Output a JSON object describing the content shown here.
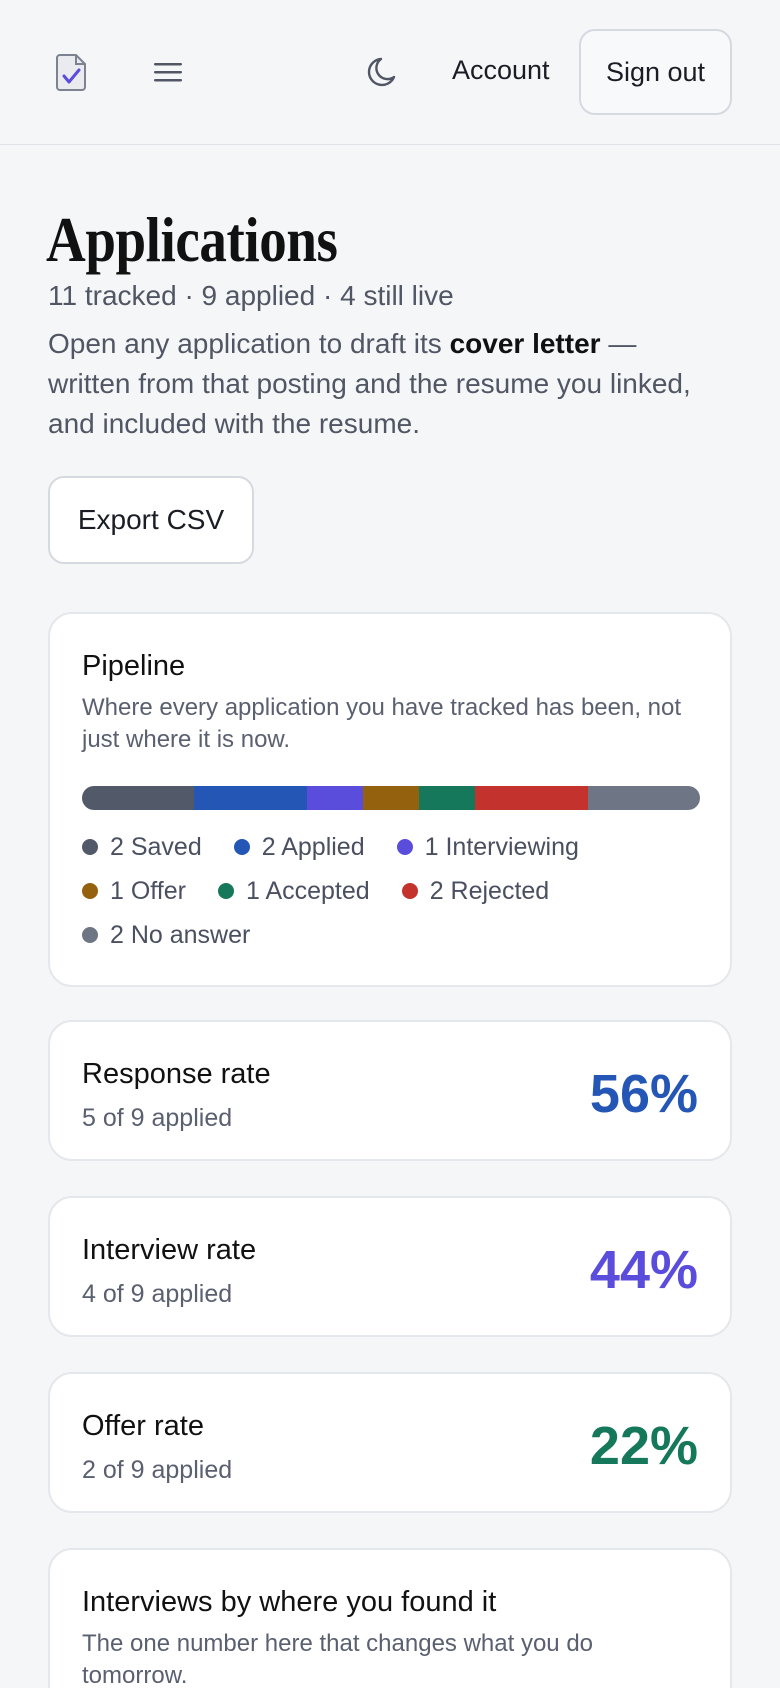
{
  "header": {
    "account_label": "Account",
    "signout_label": "Sign out"
  },
  "page": {
    "title": "Applications",
    "subtitle": "11 tracked · 9 applied · 4 still live",
    "intro_before": "Open any application to draft its ",
    "intro_bold": "cover letter",
    "intro_after": " — written from that posting and the resume you linked, and included with the resume.",
    "export_label": "Export CSV"
  },
  "pipeline": {
    "title": "Pipeline",
    "description": "Where every application you have tracked has been, not just where it is now.",
    "stages": [
      {
        "count": 2,
        "label": "Saved",
        "text": "2 Saved",
        "color": "#525a69"
      },
      {
        "count": 2,
        "label": "Applied",
        "text": "2 Applied",
        "color": "#2456b5"
      },
      {
        "count": 1,
        "label": "Interviewing",
        "text": "1 Interviewing",
        "color": "#5b4ddc"
      },
      {
        "count": 1,
        "label": "Offer",
        "text": "1 Offer",
        "color": "#94610e"
      },
      {
        "count": 1,
        "label": "Accepted",
        "text": "1 Accepted",
        "color": "#16785a"
      },
      {
        "count": 2,
        "label": "Rejected",
        "text": "2 Rejected",
        "color": "#c4322d"
      },
      {
        "count": 2,
        "label": "No answer",
        "text": "2 No answer",
        "color": "#6e7685"
      }
    ]
  },
  "stats": [
    {
      "title": "Response rate",
      "sub": "5 of 9 applied",
      "value": "56%",
      "color": "#2456b5"
    },
    {
      "title": "Interview rate",
      "sub": "4 of 9 applied",
      "value": "44%",
      "color": "#5b4ddc"
    },
    {
      "title": "Offer rate",
      "sub": "2 of 9 applied",
      "value": "22%",
      "color": "#16785a"
    }
  ],
  "sources": {
    "title": "Interviews by where you found it",
    "description": "The one number here that changes what you do tomorrow."
  },
  "icons": {
    "logo": "document-check-icon",
    "menu": "menu-icon",
    "theme": "moon-icon"
  }
}
